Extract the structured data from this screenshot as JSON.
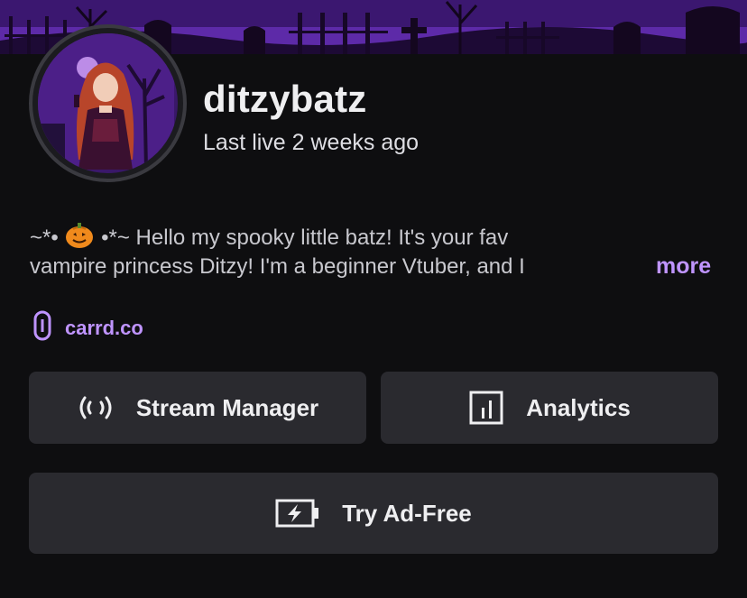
{
  "profile": {
    "username": "ditzybatz",
    "last_live": "Last live 2 weeks ago"
  },
  "bio": {
    "prefix_before_icon": "~*•",
    "prefix_after_icon": "•*~ Hello my spooky little batz! It's your fav",
    "line2": "vampire princess Ditzy! I'm a beginner Vtuber, and I",
    "more_label": "more"
  },
  "link": {
    "label": "carrd.co"
  },
  "buttons": {
    "stream_manager": "Stream Manager",
    "analytics": "Analytics",
    "ad_free": "Try Ad-Free"
  },
  "colors": {
    "background": "#0e0e10",
    "button_bg": "#2a2a2f",
    "accent_purple": "#bf94ff",
    "text_primary": "#efeff1",
    "text_secondary": "#c8c8ce"
  },
  "icons": {
    "link": "link-chain-icon",
    "stream_manager": "broadcast-icon",
    "analytics": "bar-chart-icon",
    "ad_free": "battery-bolt-icon",
    "bio_emoji": "pumpkin-icon"
  }
}
